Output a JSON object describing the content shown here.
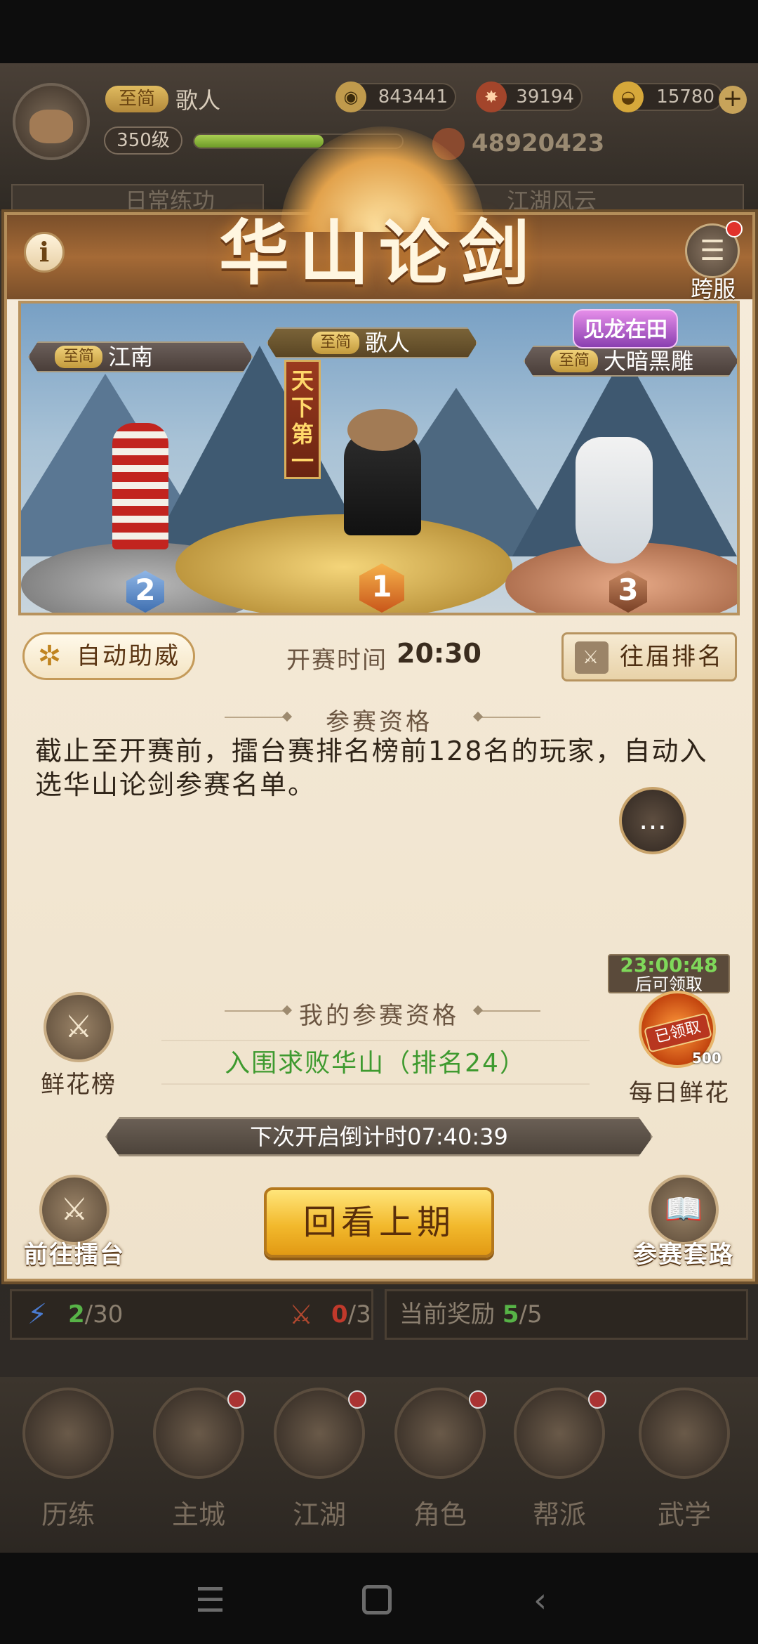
{
  "header": {
    "vip_label": "至简",
    "player_name": "歌人",
    "level": "350级",
    "xp_progress": 0.62,
    "coins": "843441",
    "gems": "39194",
    "gold": "15780",
    "combat_power": "48920423",
    "plus_symbol": "+"
  },
  "background_tabs": {
    "left": "日常练功",
    "right": "江湖风云"
  },
  "dialog": {
    "title": "华山论剑",
    "info_symbol": "i",
    "server_label": "跨服",
    "podium": {
      "special_title": "见龙在田",
      "banner": "天下第一",
      "players": [
        {
          "rank": "2",
          "vip": "至简",
          "name": "江南"
        },
        {
          "rank": "1",
          "vip": "至简",
          "name": "歌人"
        },
        {
          "rank": "3",
          "vip": "至简",
          "name": "大暗黑雕"
        }
      ]
    },
    "auto_cheer_label": "自动助威",
    "start_time_label": "开赛时间",
    "start_time_value": "20:30",
    "history_rank_label": "往届排名",
    "qualification_title": "参赛资格",
    "qualification_text": "截止至开赛前，擂台赛排名榜前128名的玩家，自动入选华山论剑参赛名单。",
    "my_qualification_title": "我的参赛资格",
    "my_qualification_value": "入围求败华山（排名24）",
    "flower_rank_label": "鲜花榜",
    "daily_flower": {
      "timer": "23:00:48",
      "timer_hint": "后可领取",
      "claimed_badge": "已领取",
      "count": "500",
      "label": "每日鲜花"
    },
    "countdown_text": "下次开启倒计时07:40:39",
    "goto_arena_label": "前往擂台",
    "replay_label": "回看上期",
    "strategy_label": "参赛套路"
  },
  "bottom_stats": {
    "energy_current": "2",
    "energy_total": "/30",
    "kills_current": "0",
    "kills_total": "/3",
    "reward_label": "当前奖励",
    "reward_current": "5",
    "reward_total": "/5"
  },
  "nav": [
    {
      "label": "历练"
    },
    {
      "label": "主城"
    },
    {
      "label": "江湖"
    },
    {
      "label": "角色"
    },
    {
      "label": "帮派"
    },
    {
      "label": "武学"
    }
  ],
  "system_nav": {
    "menu_icon": "menu-icon",
    "home_icon": "home-icon",
    "back_icon": "back-icon"
  }
}
